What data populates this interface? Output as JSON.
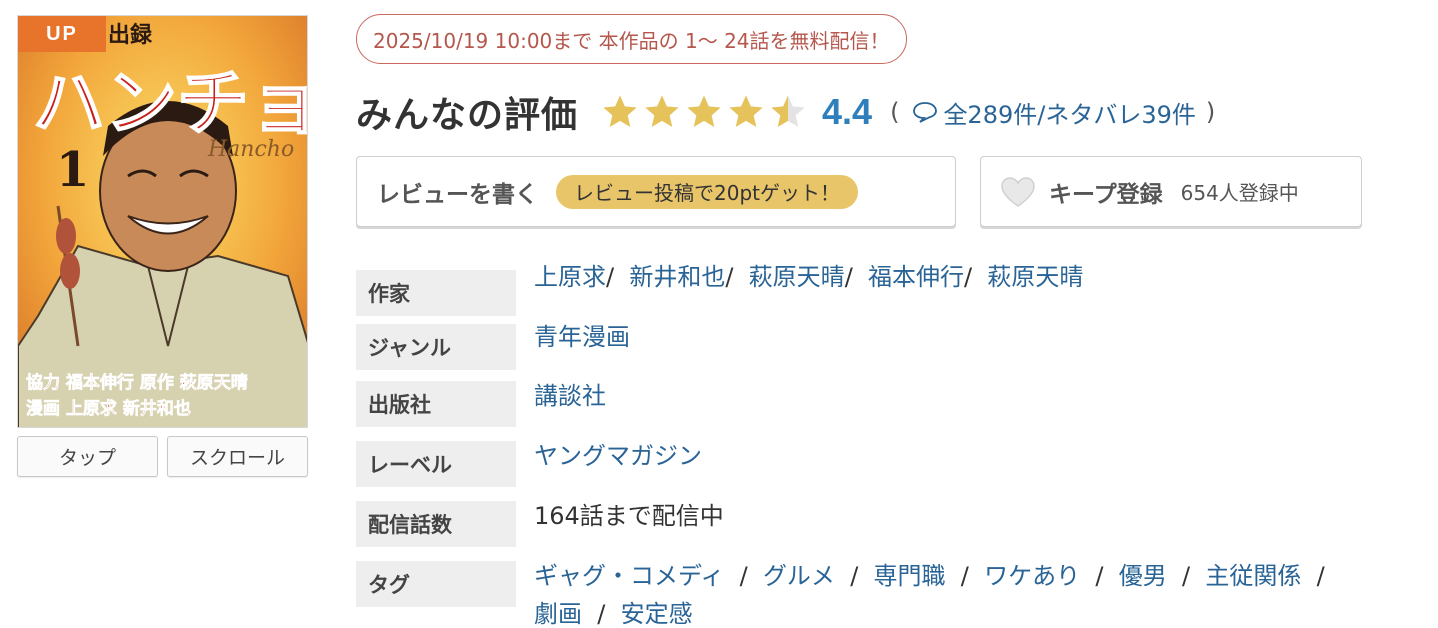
{
  "cover": {
    "badge": "UP",
    "title_text": "ハンチョウ",
    "top_text": "出録",
    "volume": "1",
    "subtitle": "Hancho",
    "credit_line1": "協力 福本伸行 原作 萩原天晴",
    "credit_line2": "漫画 上原求 新井和也"
  },
  "view_buttons": [
    "タップ",
    "スクロール"
  ],
  "promo": {
    "text": "2025/10/19 10:00まで 本作品の 1〜 24話を無料配信！"
  },
  "rating": {
    "title": "みんなの評価",
    "score": "4.4",
    "stars_value": 4.4,
    "open_paren": "(",
    "count_text": "全289件/ネタバレ39件",
    "close_paren": ")",
    "star_color": "#e6c25a",
    "empty_star_color": "#e3e3e3"
  },
  "actions": {
    "review_label": "レビューを書く",
    "review_badge": "レビュー投稿で20ptゲット！",
    "keep_label": "キープ登録",
    "keep_count": "654人登録中"
  },
  "info": {
    "author_label": "作家",
    "authors": [
      "上原求",
      "新井和也",
      "萩原天晴",
      "福本伸行",
      "萩原天晴"
    ],
    "genre_label": "ジャンル",
    "genre": "青年漫画",
    "publisher_label": "出版社",
    "publisher": "講談社",
    "imprint_label": "レーベル",
    "imprint": "ヤングマガジン",
    "episodes_label": "配信話数",
    "episodes": "164話まで配信中",
    "tags_label": "タグ",
    "tags": [
      "ギャグ・コメディ",
      "グルメ",
      "専門職",
      "ワケあり",
      "優男",
      "主従関係",
      "劇画",
      "安定感"
    ]
  }
}
